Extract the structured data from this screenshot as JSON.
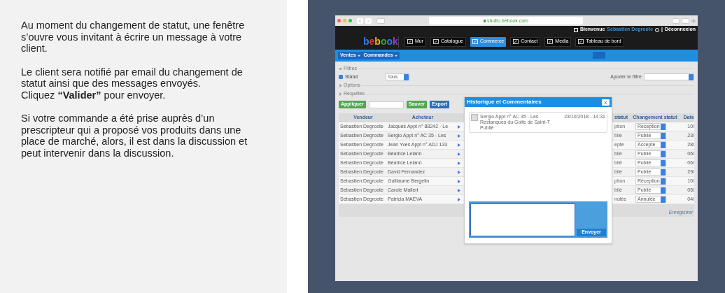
{
  "instructions": [
    [
      "Au moment du changement de statut, une fenêtre s’ouvre vous invitant à écrire un message à votre client."
    ],
    [
      "Le client sera notifié par email du changement de statut ainsi que des messages envoyés.",
      "Cliquez **“Valider”** pour envoyer."
    ],
    [
      "Si votre commande a été prise auprès d’un prescripteur qui a proposé vos produits dans une place de marché, alors, il est dans la discussion et peut intervenir dans la discussion."
    ]
  ],
  "browser": {
    "url": "studio.bebook.com"
  },
  "app": {
    "logo": "bebook",
    "nav": [
      {
        "label": "Mur",
        "selected": false
      },
      {
        "label": "Catalogue",
        "selected": false
      },
      {
        "label": "Commerce",
        "selected": true
      },
      {
        "label": "Contact",
        "selected": false
      },
      {
        "label": "Media",
        "selected": false
      },
      {
        "label": "Tableau de bord",
        "selected": false
      }
    ],
    "user": {
      "welcome": "Bienvenue",
      "name": "Sebastien Degroote",
      "separator": "|",
      "logout": "Déconnexion"
    },
    "breadcrumbs": [
      "Ventes",
      "Commandes"
    ],
    "filters": {
      "sections": [
        {
          "label": "Filtres",
          "expanded": true
        },
        {
          "label": "Options",
          "expanded": false
        },
        {
          "label": "Requêtes",
          "expanded": false
        }
      ],
      "statut": {
        "label": "Statut",
        "checked": true,
        "value": "tous"
      },
      "add_filter": {
        "label": "Ajouter le filtre"
      }
    },
    "buttons": [
      {
        "label": "Appliquer",
        "kind": "green"
      },
      {
        "kind": "input"
      },
      {
        "label": "Sauver",
        "kind": "green"
      },
      {
        "label": "Export",
        "kind": "blue"
      }
    ],
    "table": {
      "columns": [
        "Vendeur",
        "Acheteur",
        "statut",
        "Changement statut",
        "Date"
      ],
      "rows": [
        {
          "vendor": "Sebastien Degroote",
          "buyer": "Jacques Appt n° 88242 - Le",
          "status": "ption",
          "change": "Réception",
          "date": "10/"
        },
        {
          "vendor": "Sebastien Degroote",
          "buyer": "Sergio Appt n° AC 35 - Les",
          "status": "blié",
          "change": "Publié",
          "date": "23/"
        },
        {
          "vendor": "Sebastien Degroote",
          "buyer": "Jean Yves Appt n° ADJ 133",
          "status": "epté",
          "change": "Accepté",
          "date": "28/"
        },
        {
          "vendor": "Sebastien Degroote",
          "buyer": "Béatrice Lelann",
          "status": "blié",
          "change": "Publié",
          "date": "06/"
        },
        {
          "vendor": "Sebastien Degroote",
          "buyer": "Béatrice Lelann",
          "status": "blié",
          "change": "Publié",
          "date": "06/"
        },
        {
          "vendor": "Sebastien Degroote",
          "buyer": "David Fernandez",
          "status": "blié",
          "change": "Publié",
          "date": "29/"
        },
        {
          "vendor": "Sebastien Degroote",
          "buyer": "Guillaume Bergelin",
          "status": "ption",
          "change": "Réception",
          "date": "10/"
        },
        {
          "vendor": "Sebastien Degroote",
          "buyer": "Carole Mallert",
          "status": "blié",
          "change": "Publié",
          "date": "05/"
        },
        {
          "vendor": "Sebastien Degroote",
          "buyer": "Patricia MAEVA",
          "status": "nulée",
          "change": "Annulée",
          "date": "04/"
        }
      ],
      "save": "Enregistrer"
    },
    "modal": {
      "title": "Historique et Commentaires",
      "close": "x",
      "entries": [
        {
          "author": "Sergio Appt n° AC 35 - Les Restanques du Golfe de Saint-T",
          "date": "23/10/2018 - 14:31",
          "status": "Publié"
        }
      ],
      "send": "Envoyer"
    }
  }
}
